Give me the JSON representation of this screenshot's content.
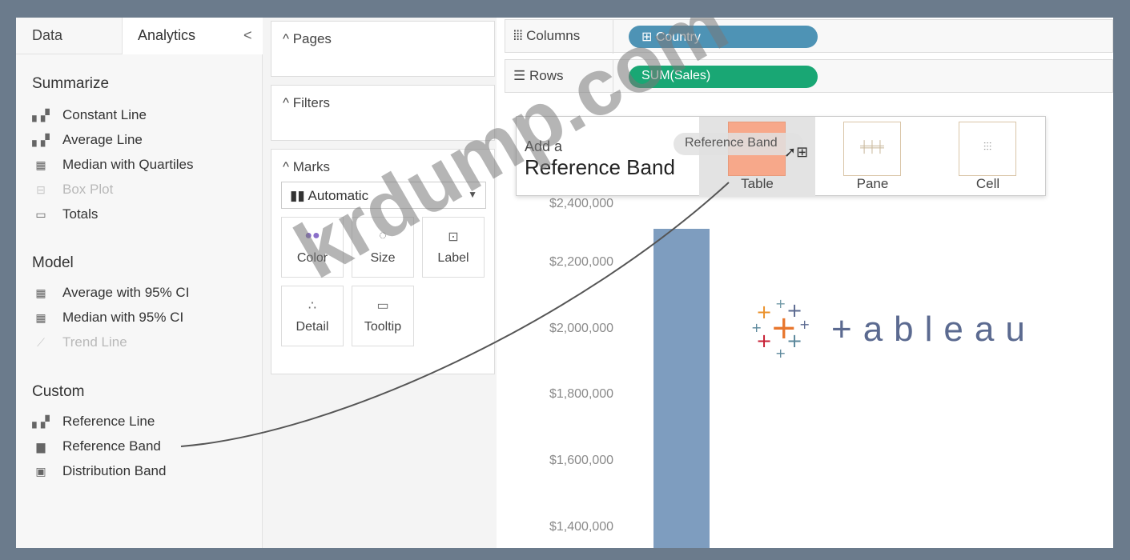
{
  "tabs": {
    "data": "Data",
    "analytics": "Analytics",
    "collapse": "<"
  },
  "summarize": {
    "title": "Summarize",
    "items": [
      "Constant Line",
      "Average Line",
      "Median with Quartiles",
      "Box Plot",
      "Totals"
    ]
  },
  "model": {
    "title": "Model",
    "items": [
      "Average with 95% CI",
      "Median with 95% CI",
      "Trend Line"
    ]
  },
  "custom": {
    "title": "Custom",
    "items": [
      "Reference Line",
      "Reference Band",
      "Distribution Band"
    ]
  },
  "shelves": {
    "pages": "Pages",
    "filters": "Filters",
    "marks": "Marks",
    "mark_type": "Automatic",
    "buttons": [
      "Color",
      "Size",
      "Label",
      "Detail",
      "Tooltip"
    ],
    "columns": "Columns",
    "rows": "Rows",
    "columns_pill": "⊞ Country",
    "rows_pill": "SUM(Sales)"
  },
  "view": {
    "y_ticks": [
      "$2,400,000",
      "$2,200,000",
      "$2,000,000",
      "$1,800,000",
      "$1,600,000",
      "$1,400,000"
    ],
    "bar_value": "$2,300,000"
  },
  "dropzone": {
    "add": "Add a",
    "title": "Reference Band",
    "drag_label": "Reference Band",
    "options": [
      "Table",
      "Pane",
      "Cell"
    ]
  },
  "logo": {
    "word": "+ableau"
  },
  "watermark": "krdump.com",
  "colors": {
    "columns_pill": "#4e93b5",
    "rows_pill": "#19a774",
    "bar": "#7e9dbf",
    "table_box": "#f7a88a"
  }
}
